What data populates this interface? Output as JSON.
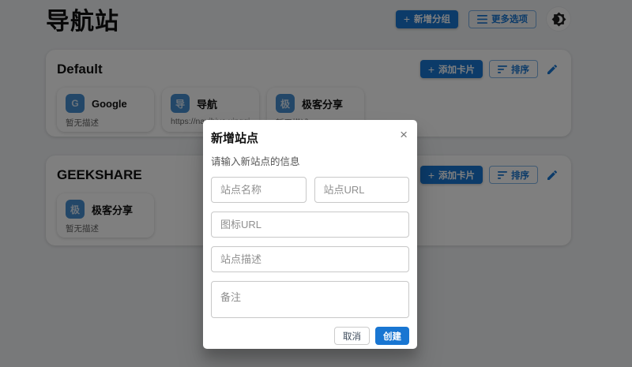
{
  "app": {
    "title": "导航站"
  },
  "colors": {
    "primary": "#1976d2",
    "overlay": "rgba(0,0,0,0.5)"
  },
  "icons": {
    "plus": "+",
    "close": "×"
  },
  "header": {
    "add_group_label": "新增分组",
    "more_options_label": "更多选项"
  },
  "groups": [
    {
      "name": "Default",
      "add_card_label": "添加卡片",
      "sort_label": "排序",
      "cards": [
        {
          "icon_glyph": "G",
          "title": "Google",
          "subtitle": "暂无描述"
        },
        {
          "icon_glyph": "导",
          "title": "导航",
          "subtitle": "https://navihive.xingqiong.i"
        },
        {
          "icon_glyph": "极",
          "title": "极客分享",
          "subtitle": "暂无描述"
        }
      ]
    },
    {
      "name": "GEEKSHARE",
      "add_card_label": "添加卡片",
      "sort_label": "排序",
      "cards": [
        {
          "icon_glyph": "极",
          "title": "极客分享",
          "subtitle": "暂无描述"
        }
      ]
    }
  ],
  "modal": {
    "title": "新增站点",
    "subtitle": "请输入新站点的信息",
    "fields": {
      "site_name_placeholder": "站点名称",
      "site_url_placeholder": "站点URL",
      "icon_url_placeholder": "图标URL",
      "site_desc_placeholder": "站点描述",
      "note_placeholder": "备注"
    },
    "cancel_label": "取消",
    "create_label": "创建"
  }
}
